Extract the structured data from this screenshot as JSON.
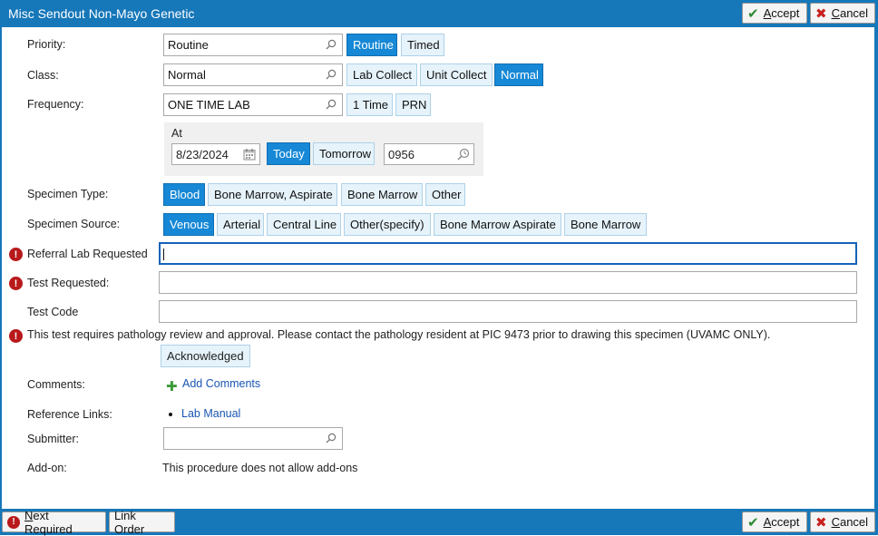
{
  "window": {
    "title": "Misc Sendout Non-Mayo Genetic"
  },
  "header": {
    "accept_pre": "",
    "accept_u": "A",
    "accept_post": "ccept",
    "cancel_pre": "",
    "cancel_u": "C",
    "cancel_post": "ancel"
  },
  "priority": {
    "label": "Priority:",
    "value": "Routine",
    "options": [
      "Routine",
      "Timed"
    ]
  },
  "class": {
    "label": "Class:",
    "value": "Normal",
    "options": [
      "Lab Collect",
      "Unit Collect",
      "Normal"
    ]
  },
  "frequency": {
    "label": "Frequency:",
    "value": "ONE TIME LAB",
    "options": [
      "1 Time",
      "PRN"
    ]
  },
  "at": {
    "label": "At",
    "date": "8/23/2024",
    "today": "Today",
    "tomorrow": "Tomorrow",
    "time": "0956"
  },
  "specimen_type": {
    "label": "Specimen Type:",
    "options": [
      "Blood",
      "Bone Marrow, Aspirate",
      "Bone Marrow",
      "Other"
    ]
  },
  "specimen_source": {
    "label": "Specimen Source:",
    "options": [
      "Venous",
      "Arterial",
      "Central Line",
      "Other(specify)",
      "Bone Marrow Aspirate",
      "Bone Marrow"
    ]
  },
  "referral_lab": {
    "label": "Referral Lab Requested",
    "value": ""
  },
  "test_requested": {
    "label": "Test Requested:",
    "value": ""
  },
  "test_code": {
    "label": "Test Code",
    "value": ""
  },
  "pathology_message": "This test requires pathology review and approval. Please contact the pathology resident at PIC 9473 prior to drawing this specimen (UVAMC ONLY).",
  "acknowledged": "Acknowledged",
  "comments": {
    "label": "Comments:",
    "link": "Add Comments"
  },
  "reference_links": {
    "label": "Reference Links:",
    "link": "Lab Manual"
  },
  "submitter": {
    "label": "Submitter:",
    "value": ""
  },
  "add_on": {
    "label": "Add-on:",
    "text": "This procedure does not allow add-ons"
  },
  "footer": {
    "next_pre": "",
    "next_u": "N",
    "next_post": "ext Required",
    "link_order": "Link Order"
  },
  "colors": {
    "titlebar": "#1677b9",
    "selected": "#1688d6",
    "option": "#e6f3fb",
    "required": "#b8191b",
    "link": "#1a55b4"
  },
  "icons": [
    "check-icon",
    "x-icon",
    "search-icon",
    "calendar-icon",
    "clock-search-icon",
    "required-icon",
    "plus-icon"
  ]
}
